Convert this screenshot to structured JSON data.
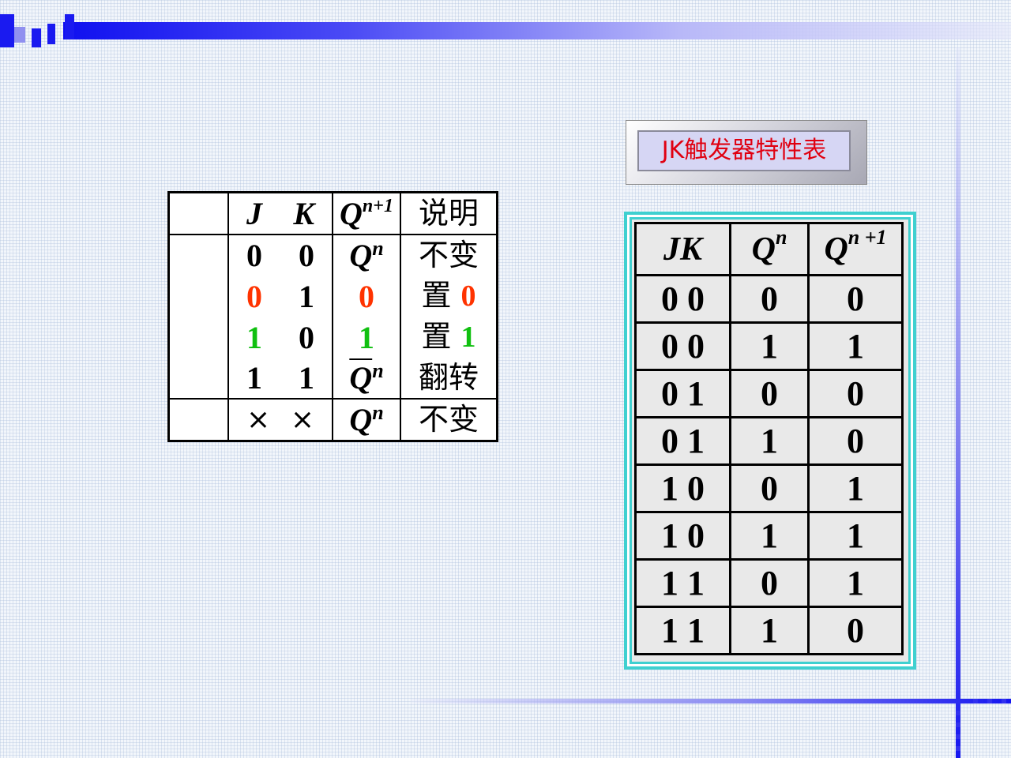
{
  "left_table": {
    "header": {
      "j": "J",
      "k": "K",
      "q": "Q",
      "q_sup": "n+1",
      "desc": "说明"
    },
    "rows": [
      {
        "j": "0",
        "k": "0",
        "q": "Q",
        "q_sup": "n",
        "desc": "不变"
      },
      {
        "j": "0",
        "k": "1",
        "q": "0",
        "desc": "置",
        "desc_num": "0"
      },
      {
        "j": "1",
        "k": "0",
        "q": "1",
        "desc": "置",
        "desc_num": "1"
      },
      {
        "j": "1",
        "k": "1",
        "q": "Q",
        "q_sup": "n",
        "desc": "翻转"
      }
    ],
    "last_row": {
      "j": "×",
      "k": "×",
      "q": "Q",
      "q_sup": "n",
      "desc": "不变"
    }
  },
  "title_button": {
    "label": "JK触发器特性表"
  },
  "right_table": {
    "headers": {
      "jk": "JK",
      "qn": "Q",
      "qn_sup": "n",
      "qn1": "Q",
      "qn1_sup": "n +1"
    },
    "rows": [
      {
        "jk": "0 0",
        "qn": "0",
        "qn1": "0"
      },
      {
        "jk": "0 0",
        "qn": "1",
        "qn1": "1"
      },
      {
        "jk": "0 1",
        "qn": "0",
        "qn1": "0"
      },
      {
        "jk": "0 1",
        "qn": "1",
        "qn1": "0"
      },
      {
        "jk": "1 0",
        "qn": "0",
        "qn1": "1"
      },
      {
        "jk": "1 0",
        "qn": "1",
        "qn1": "1"
      },
      {
        "jk": "1 1",
        "qn": "0",
        "qn1": "1"
      },
      {
        "jk": "1 1",
        "qn": "1",
        "qn1": "0"
      }
    ]
  },
  "colors": {
    "accent_red": "#ff3300",
    "accent_green": "#10c010",
    "title_red": "#e00010",
    "frame_cyan": "#3fd0d0",
    "bar_blue": "#1515f0"
  }
}
